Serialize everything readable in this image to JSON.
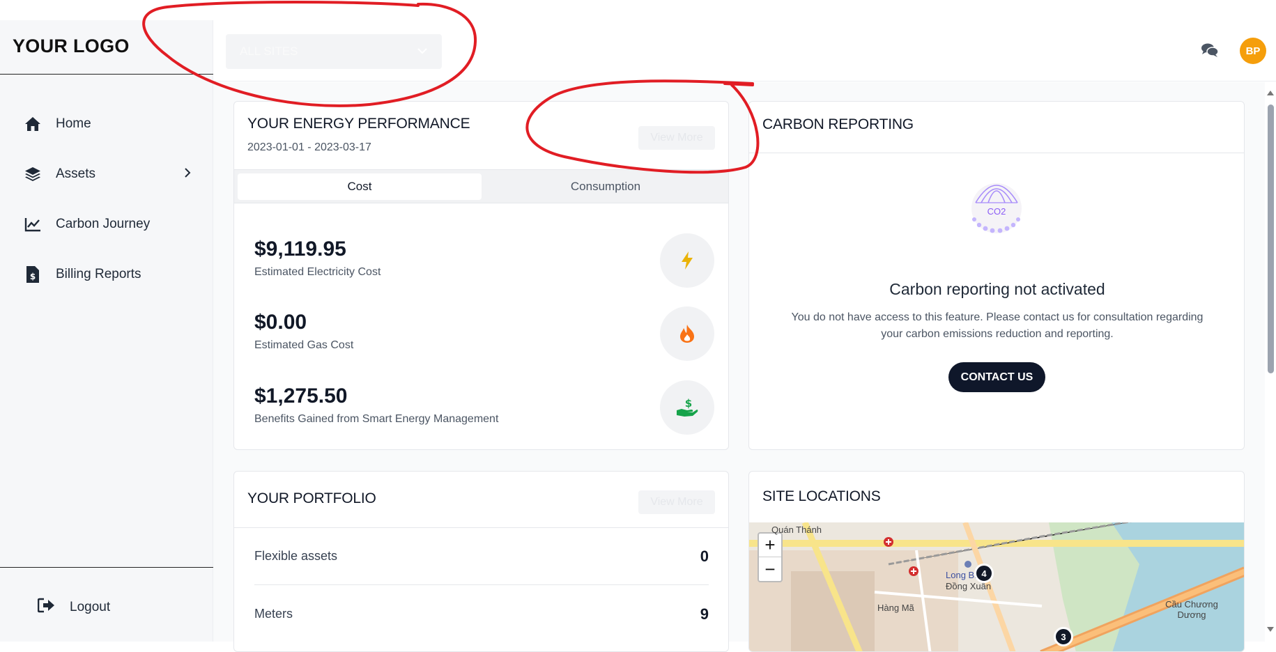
{
  "brand": {
    "logo_text": "YOUR LOGO"
  },
  "sidebar": {
    "items": [
      {
        "label": "Home",
        "icon": "home-icon"
      },
      {
        "label": "Assets",
        "icon": "layers-icon"
      },
      {
        "label": "Carbon Journey",
        "icon": "chart-line-icon"
      },
      {
        "label": "Billing Reports",
        "icon": "invoice-icon"
      }
    ],
    "logout_label": "Logout"
  },
  "header": {
    "site_select_value": "ALL SITES",
    "avatar_initials": "BP"
  },
  "energy": {
    "title": "YOUR ENERGY PERFORMANCE",
    "date_range": "2023-01-01 - 2023-03-17",
    "view_more": "View More",
    "tabs": [
      {
        "label": "Cost"
      },
      {
        "label": "Consumption"
      }
    ],
    "metrics": [
      {
        "value": "$9,119.95",
        "label": "Estimated Electricity Cost",
        "icon": "lightning-icon",
        "color": "#eab308"
      },
      {
        "value": "$0.00",
        "label": "Estimated Gas Cost",
        "icon": "flame-icon",
        "color": "#f97316"
      },
      {
        "value": "$1,275.50",
        "label": "Benefits Gained from Smart Energy Management",
        "icon": "hand-dollar-icon",
        "color": "#16a34a"
      }
    ]
  },
  "carbon": {
    "title": "CARBON REPORTING",
    "badge_text": "CO2",
    "heading": "Carbon reporting not activated",
    "message": "You do not have access to this feature. Please contact us for consultation regarding your carbon emissions reduction and reporting.",
    "button": "CONTACT US"
  },
  "portfolio": {
    "title": "YOUR PORTFOLIO",
    "view_more": "View More",
    "rows": [
      {
        "label": "Flexible assets",
        "value": "0"
      },
      {
        "label": "Meters",
        "value": "9"
      }
    ]
  },
  "sites": {
    "title": "SITE LOCATIONS",
    "zoom_in": "+",
    "zoom_out": "−",
    "labels": [
      "Quán Thánh",
      "Hàng Mã",
      "Long Biên",
      "Đồng Xuân",
      "Cầu Chương Dương"
    ],
    "clusters": [
      "4",
      "3"
    ]
  },
  "colors": {
    "accent": "#f59e0b",
    "dark": "#0f172a",
    "annotation": "#e11d24"
  }
}
